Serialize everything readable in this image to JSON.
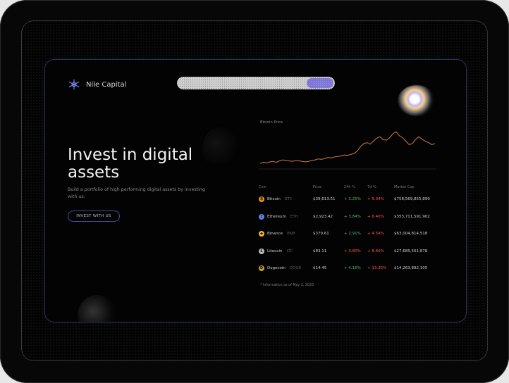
{
  "brand": {
    "name": "Nile Capital"
  },
  "hero": {
    "title": "Invest in digital assets",
    "subtitle": "Build a portfolio of high performing digital assets by investing with us.",
    "cta_label": "INVEST WITH US"
  },
  "chart": {
    "title": "Bitcoin Price"
  },
  "chart_data": {
    "type": "line",
    "title": "Bitcoin Price",
    "xlabel": "",
    "ylabel": "",
    "grid": false,
    "legend": "none",
    "series": [
      {
        "values": [
          10,
          12,
          11,
          13,
          14,
          12,
          15,
          17,
          16,
          15,
          14,
          16,
          15,
          14,
          13,
          14,
          16,
          17,
          19,
          18,
          20,
          22,
          21,
          23,
          24,
          25,
          27,
          26,
          28,
          30,
          35,
          44,
          50,
          52,
          49,
          55,
          61,
          64,
          58,
          57,
          62,
          70,
          74,
          66,
          62,
          55,
          48,
          50,
          58,
          64,
          59,
          55,
          52,
          48,
          50
        ]
      }
    ],
    "ylim": [
      0,
      80
    ],
    "color": "#d17a3a"
  },
  "table": {
    "headers": [
      "Coin",
      "Price",
      "24h %",
      "7d %",
      "Market Cap"
    ],
    "rows": [
      {
        "name": "Bitcoin",
        "symbol": "BTC",
        "price": "$39,613.51",
        "h24": "+ 3.25%",
        "d7": "+ 5.34%",
        "cap": "$758,569,855,899",
        "h24_dir": "up",
        "d7_dir": "down",
        "color": "#f7931a",
        "glyph": "₿"
      },
      {
        "name": "Ethereum",
        "symbol": "ETH",
        "price": "$2,923.42",
        "h24": "+ 3.84%",
        "d7": "+ 6.40%",
        "cap": "$353,711,591,902",
        "h24_dir": "up",
        "d7_dir": "down",
        "color": "#627eea",
        "glyph": "Ξ"
      },
      {
        "name": "Binance",
        "symbol": "BNB",
        "price": "$379.61",
        "h24": "+ 2.91%",
        "d7": "+ 4.54%",
        "cap": "$63,004,814,518",
        "h24_dir": "up",
        "d7_dir": "down",
        "color": "#f3ba2f",
        "glyph": "◆"
      },
      {
        "name": "Litecoin",
        "symbol": "LTC",
        "price": "$83.11",
        "h24": "+ 3.80%",
        "d7": "+ 8.60%",
        "cap": "$27,685,561,878",
        "h24_dir": "down",
        "d7_dir": "down",
        "color": "#bfbbbb",
        "glyph": "Ł"
      },
      {
        "name": "Dogecoin",
        "symbol": "DOGE",
        "price": "$14.45",
        "h24": "+ 4.16%",
        "d7": "+ 13.35%",
        "cap": "$14,263,892,105",
        "h24_dir": "up",
        "d7_dir": "down",
        "color": "#c2a633",
        "glyph": "Ð"
      }
    ],
    "footnote": "* Information as of May 1, 2023"
  },
  "colors": {
    "accent": "#7d74d8",
    "positive": "#4cc06f",
    "negative": "#ff5a4a",
    "chart_line": "#d17a3a"
  }
}
